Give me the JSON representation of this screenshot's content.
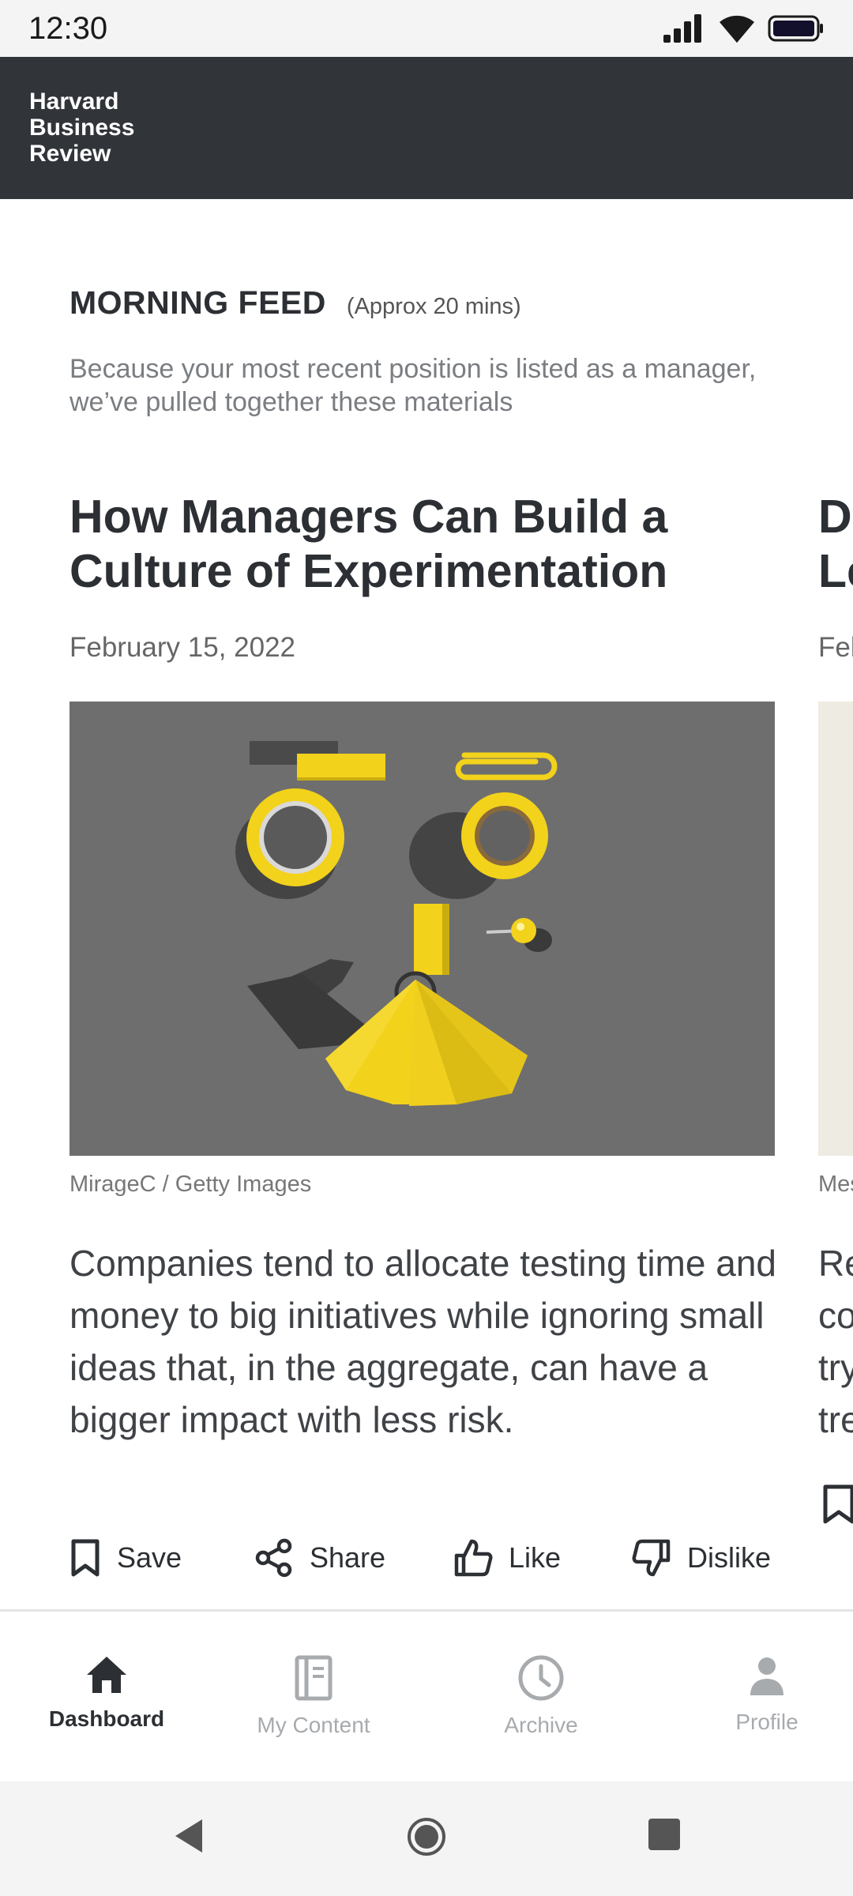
{
  "status_bar": {
    "time": "12:30"
  },
  "header": {
    "logo": "Harvard\nBusiness\nReview"
  },
  "feed": {
    "title": "MORNING FEED",
    "duration": "(Approx 20 mins)",
    "description": "Because your most recent position is listed as a manager, we’ve pulled together these materials"
  },
  "articles": [
    {
      "title": "How Managers Can Build a Culture of Experimentation",
      "date": "February 15, 2022",
      "image_credit": "MirageC / Getty Images",
      "summary": "Companies tend to allocate testing time and money to big initiatives while ignoring small ideas that, in the aggregate, can have a bigger impact with less risk."
    },
    {
      "title_line1": "D",
      "title_line2": "Le",
      "date": "Fel",
      "image_credit": "Mes",
      "summary_lines": [
        "Re",
        "co",
        "try",
        "tre"
      ]
    }
  ],
  "actions": {
    "save": "Save",
    "share": "Share",
    "like": "Like",
    "dislike": "Dislike"
  },
  "bottom_nav": [
    {
      "label": "Dashboard",
      "icon": "home-icon",
      "active": true
    },
    {
      "label": "My Content",
      "icon": "notebook-icon",
      "active": false
    },
    {
      "label": "Archive",
      "icon": "clock-icon",
      "active": false
    },
    {
      "label": "Profile",
      "icon": "person-icon",
      "active": false
    }
  ],
  "colors": {
    "header_bg": "#31353a",
    "text_primary": "#2c2f33",
    "nav_inactive": "#a8abae",
    "image_bg": "#6e6e6e",
    "accent_yellow": "#f2d21b"
  }
}
